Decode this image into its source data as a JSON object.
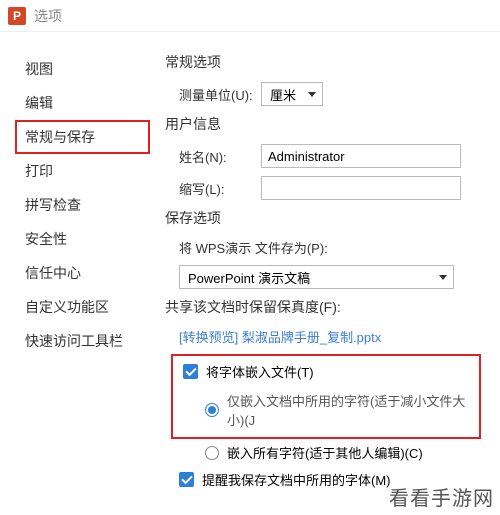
{
  "window": {
    "logo_letter": "P",
    "title": "选项"
  },
  "sidebar": {
    "items": [
      {
        "label": "视图"
      },
      {
        "label": "编辑"
      },
      {
        "label": "常规与保存"
      },
      {
        "label": "打印"
      },
      {
        "label": "拼写检查"
      },
      {
        "label": "安全性"
      },
      {
        "label": "信任中心"
      },
      {
        "label": "自定义功能区"
      },
      {
        "label": "快速访问工具栏"
      }
    ]
  },
  "sections": {
    "general": {
      "title": "常规选项",
      "unit_label": "测量单位(U):",
      "unit_value": "厘米"
    },
    "user": {
      "title": "用户信息",
      "name_label": "姓名(N):",
      "name_value": "Administrator",
      "abbrev_label": "缩写(L):",
      "abbrev_value": ""
    },
    "save": {
      "title": "保存选项",
      "saveas_label": "将 WPS演示 文件存为(P):",
      "saveas_value": "PowerPoint 演示文稿",
      "fidelity_label": "共享该文档时保留保真度(F):",
      "preview_link": "[转换预览] 梨淑品牌手册_复制.pptx",
      "embed_font_label": "将字体嵌入文件(T)",
      "embed_used_label": "仅嵌入文档中所用的字符(适于减小文件大小)(J",
      "embed_all_label": "嵌入所有字符(适于其他人编辑)(C)",
      "remind_font_label": "提醒我保存文档中所用的字体(M)"
    }
  },
  "watermark": "看看手游网"
}
